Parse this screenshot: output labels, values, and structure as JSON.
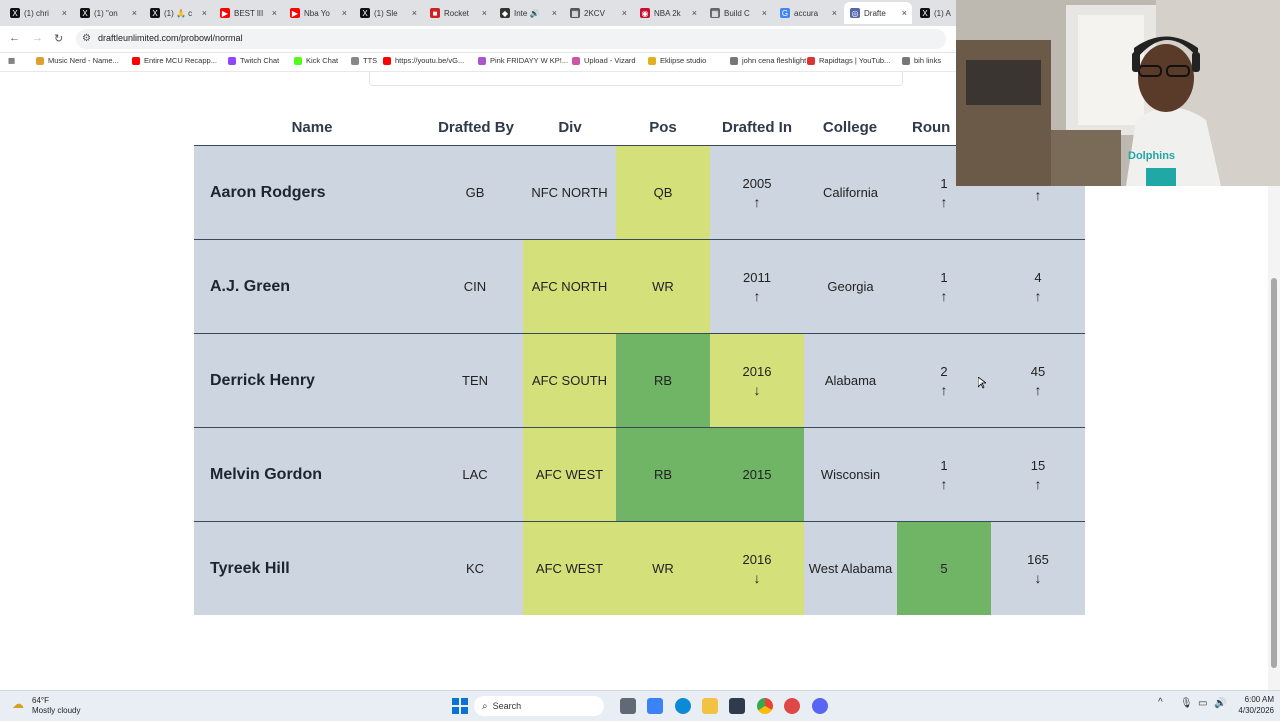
{
  "browser": {
    "tabs": [
      {
        "label": "(1) chri",
        "icon": "x-logo-icon",
        "color": "#111111",
        "glyph": "X"
      },
      {
        "label": "(1) \"on",
        "icon": "x-logo-icon",
        "color": "#111111",
        "glyph": "X"
      },
      {
        "label": "(1) 🙏 c",
        "icon": "x-logo-icon",
        "color": "#111111",
        "glyph": "X"
      },
      {
        "label": "BEST lII",
        "icon": "youtube-icon",
        "color": "#ff0000",
        "glyph": "▶"
      },
      {
        "label": "Nba Yo",
        "icon": "youtube-icon",
        "color": "#ff0000",
        "glyph": "▶"
      },
      {
        "label": "(1) Sle",
        "icon": "x-logo-icon",
        "color": "#111111",
        "glyph": "X"
      },
      {
        "label": "Rocket",
        "icon": "roblox-icon",
        "color": "#cc2222",
        "glyph": "■"
      },
      {
        "label": "Inte 🔊",
        "icon": "site-icon",
        "color": "#333333",
        "glyph": "◆"
      },
      {
        "label": "2KCV",
        "icon": "site-icon",
        "color": "#555555",
        "glyph": "▦"
      },
      {
        "label": "NBA 2k",
        "icon": "site-icon",
        "color": "#c8102e",
        "glyph": "◉"
      },
      {
        "label": "Build C",
        "icon": "site-icon",
        "color": "#666666",
        "glyph": "▦"
      },
      {
        "label": "accura",
        "icon": "google-icon",
        "color": "#4285f4",
        "glyph": "G"
      },
      {
        "label": "Drafte",
        "icon": "site-icon",
        "color": "#5566aa",
        "glyph": "◎",
        "active": true
      },
      {
        "label": "(1) A",
        "icon": "x-logo-icon",
        "color": "#111111",
        "glyph": "X"
      }
    ],
    "url": "draftleunlimited.com/probowl/normal",
    "bookmarks": [
      {
        "label": "Music Nerd - Name...",
        "color": "#e0a030"
      },
      {
        "label": "Entire MCU Recapp...",
        "color": "#ff0000"
      },
      {
        "label": "Twitch Chat",
        "color": "#9146ff"
      },
      {
        "label": "Kick Chat",
        "color": "#53fc18"
      },
      {
        "label": "TTS",
        "color": "#888888"
      },
      {
        "label": "https://youtu.be/vG...",
        "color": "#ff0000"
      },
      {
        "label": "Pink FRIDAYY W KP!...",
        "color": "#aa55cc"
      },
      {
        "label": "Upload - Vizard",
        "color": "#cc55aa"
      },
      {
        "label": "Eklipse studio",
        "color": "#e0b020"
      },
      {
        "label": "john cena fleshlight",
        "color": "#777777"
      },
      {
        "label": "Rapidtags | YouTub...",
        "color": "#dd3333"
      },
      {
        "label": "bih links",
        "color": "#777777"
      }
    ]
  },
  "table": {
    "headers": [
      "Name",
      "Drafted By",
      "Div",
      "Pos",
      "Drafted In",
      "College",
      "Roun"
    ],
    "rows": [
      {
        "name": "Aaron Rodgers",
        "team": "GB",
        "div": "NFC NORTH",
        "pos": "QB",
        "year": "2005",
        "year_arrow": "↑",
        "college": "California",
        "round": "1",
        "round_arrow": "↑",
        "pick": "",
        "pick_arrow": "↑"
      },
      {
        "name": "A.J. Green",
        "team": "CIN",
        "div": "AFC NORTH",
        "pos": "WR",
        "year": "2011",
        "year_arrow": "↑",
        "college": "Georgia",
        "round": "1",
        "round_arrow": "↑",
        "pick": "4",
        "pick_arrow": "↑"
      },
      {
        "name": "Derrick Henry",
        "team": "TEN",
        "div": "AFC SOUTH",
        "pos": "RB",
        "year": "2016",
        "year_arrow": "↓",
        "college": "Alabama",
        "round": "2",
        "round_arrow": "↑",
        "pick": "45",
        "pick_arrow": "↑"
      },
      {
        "name": "Melvin Gordon",
        "team": "LAC",
        "div": "AFC WEST",
        "pos": "RB",
        "year": "2015",
        "year_arrow": "",
        "college": "Wisconsin",
        "round": "1",
        "round_arrow": "↑",
        "pick": "15",
        "pick_arrow": "↑"
      },
      {
        "name": "Tyreek Hill",
        "team": "KC",
        "div": "AFC WEST",
        "pos": "WR",
        "year": "2016",
        "year_arrow": "↓",
        "college": "West Alabama",
        "round": "5",
        "round_arrow": "",
        "pick": "165",
        "pick_arrow": "↓"
      }
    ],
    "colors": {
      "row_bg": "#cdd5e0",
      "partial_match": "#d4e07a",
      "exact_match": "#6fb565"
    }
  },
  "webcam": {
    "shirt_text": "Dolphins"
  },
  "taskbar": {
    "weather_temp": "64°F",
    "weather_desc": "Mostly cloudy",
    "search_label": "Search",
    "time": "6:00 AM",
    "date": "4/30/2026"
  }
}
